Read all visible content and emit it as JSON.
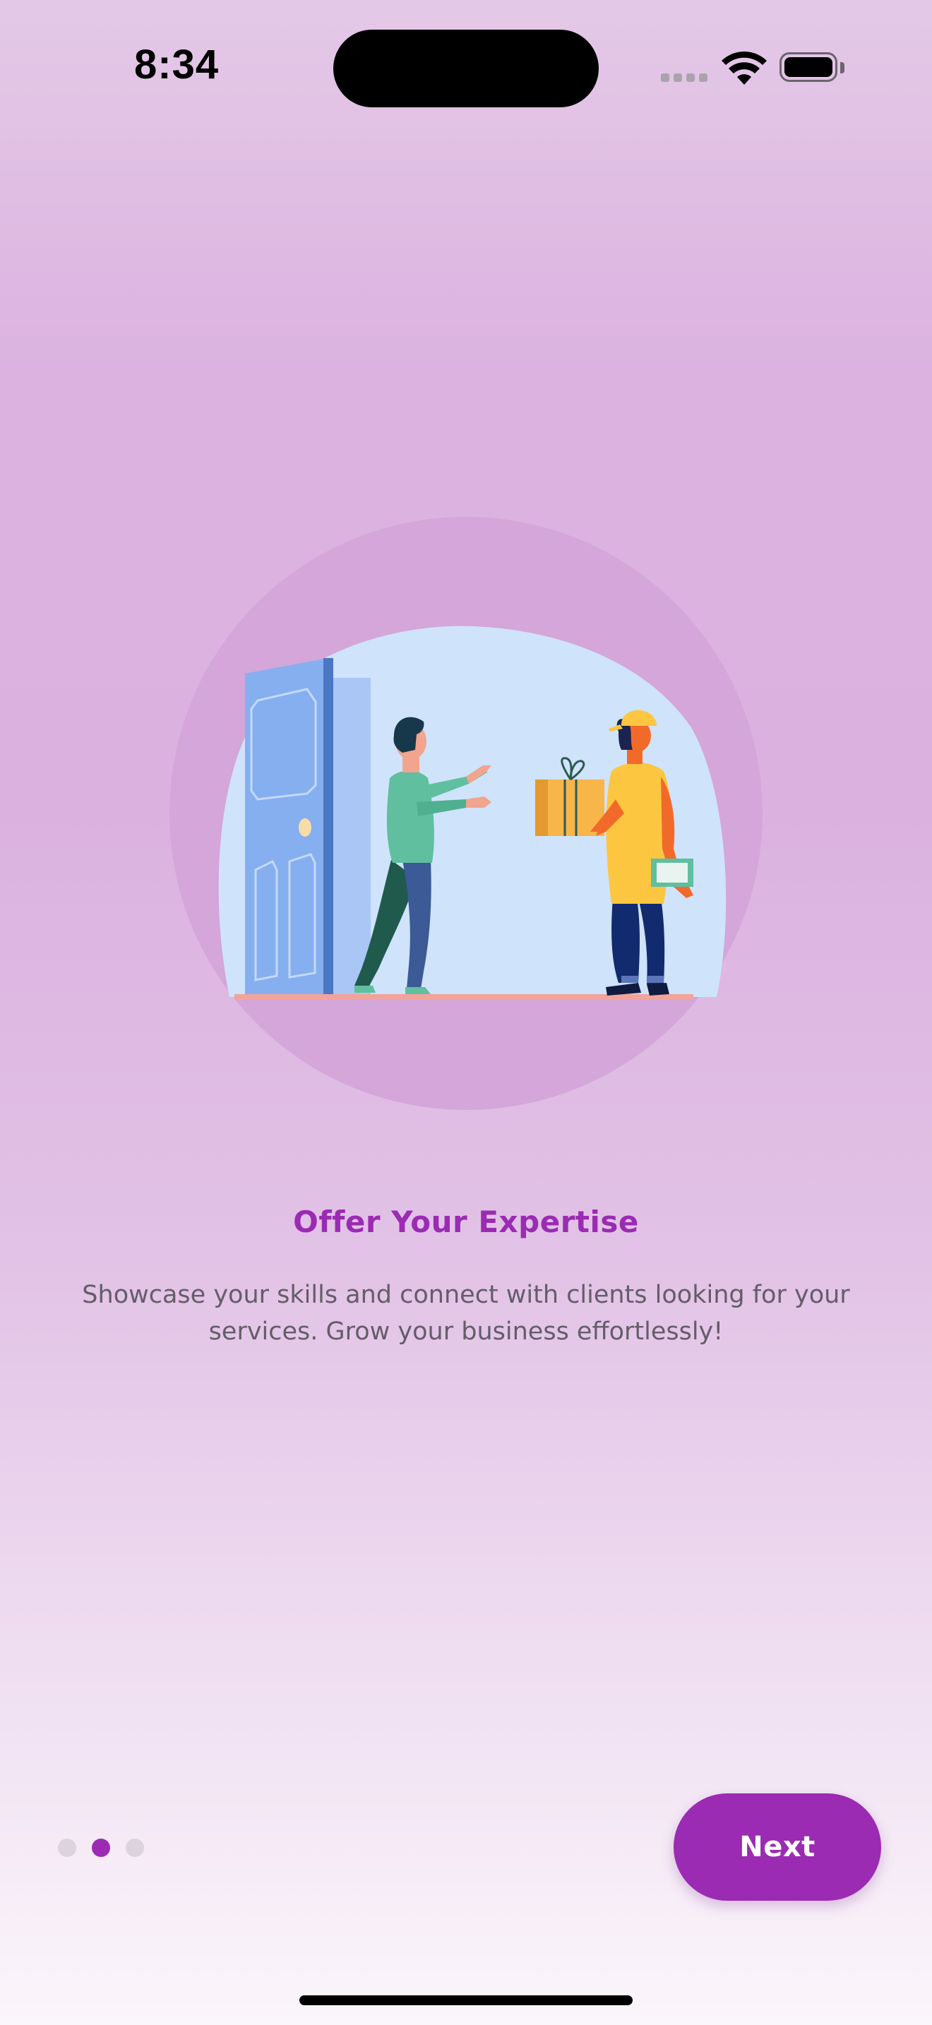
{
  "status_bar": {
    "time": "8:34",
    "icons": [
      "cellular-signal-icon",
      "wifi-icon",
      "battery-icon"
    ]
  },
  "onboarding": {
    "illustration": "delivery-handoff-illustration",
    "title": "Offer Your Expertise",
    "description_line1": "Showcase your skills and connect with clients looking for your",
    "description_line2": "services. Grow your business effortlessly!",
    "page_indicator": {
      "total": 3,
      "current": 2
    },
    "next_label": "Next"
  },
  "colors": {
    "accent": "#9a2bb2",
    "background_top": "#e4c9e7",
    "background_bottom": "#fbf6fb",
    "text_secondary": "#645d68"
  }
}
